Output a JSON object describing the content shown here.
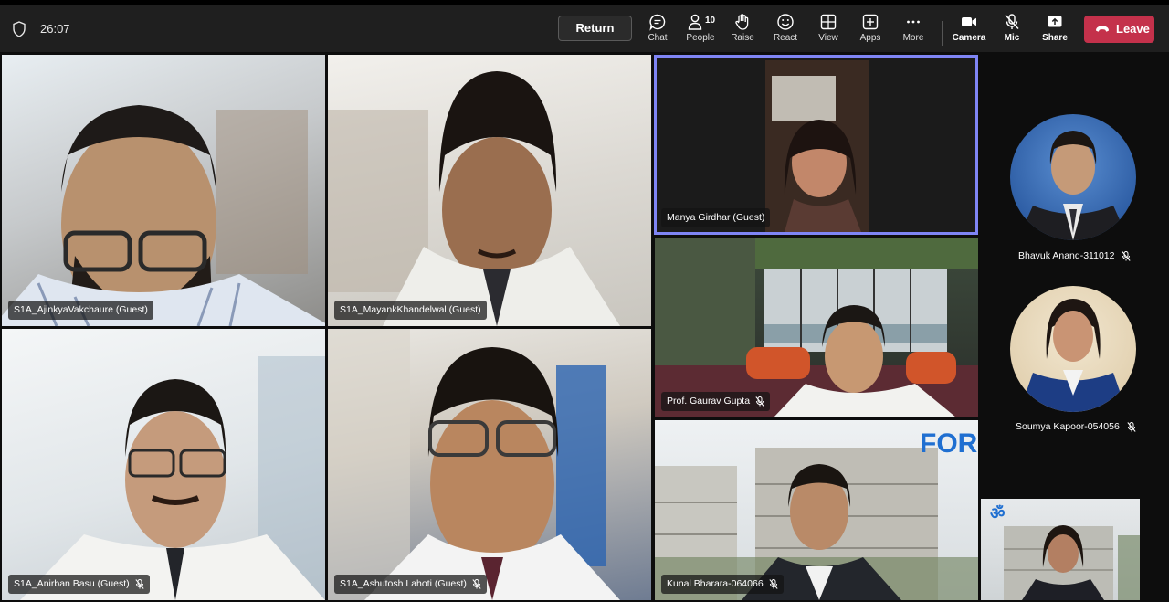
{
  "meeting": {
    "timer": "26:07"
  },
  "toolbar": {
    "return_label": "Return",
    "chat_label": "Chat",
    "people_label": "People",
    "people_count": "10",
    "raise_label": "Raise",
    "react_label": "React",
    "view_label": "View",
    "apps_label": "Apps",
    "more_label": "More",
    "camera_label": "Camera",
    "mic_label": "Mic",
    "share_label": "Share",
    "leave_label": "Leave"
  },
  "participants": [
    {
      "name": "S1A_AjinkyaVakchaure (Guest)",
      "muted": false
    },
    {
      "name": "S1A_MayankKhandelwal (Guest)",
      "muted": false
    },
    {
      "name": "S1A_Anirban Basu (Guest)",
      "muted": true
    },
    {
      "name": "S1A_Ashutosh Lahoti (Guest)",
      "muted": true
    },
    {
      "name": "Manya Girdhar (Guest)",
      "muted": false
    },
    {
      "name": "Prof. Gaurav Gupta",
      "muted": true
    },
    {
      "name": "Kunal Bharara-064066",
      "muted": true
    },
    {
      "name": "Bhavuk Anand-311012",
      "muted": true
    },
    {
      "name": "Soumya Kapoor-054056",
      "muted": true
    }
  ],
  "colors": {
    "leave": "#c4314b",
    "active_speaker_border": "#7f85f5",
    "toolbar_bg": "#1f1f1f",
    "stage_bg": "#0d0d0d"
  }
}
